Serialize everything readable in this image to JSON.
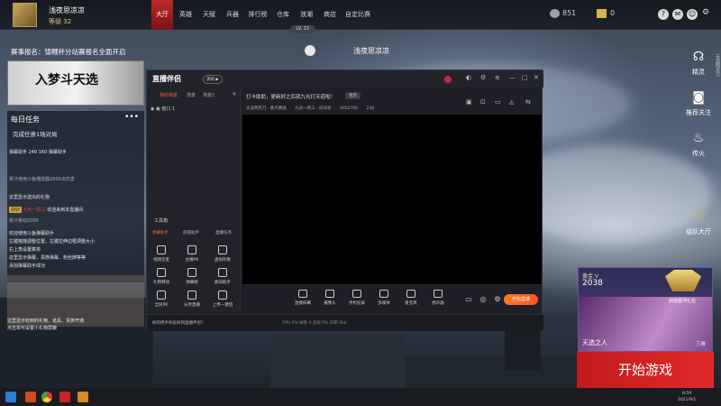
{
  "player": {
    "name": "浅夜思凉凉",
    "level": "等级 32"
  },
  "nav": {
    "tabs": [
      {
        "label": "大厅",
        "active": true
      },
      {
        "label": "英雄"
      },
      {
        "label": "天赋"
      },
      {
        "label": "兵器"
      },
      {
        "label": "排行榜"
      },
      {
        "label": "仓库"
      },
      {
        "label": "浪潮"
      },
      {
        "label": "商店"
      },
      {
        "label": "自定比赛"
      }
    ],
    "level_pill": "LV. 15",
    "currency_1": "851",
    "currency_2": "0"
  },
  "center": {
    "name": "浅夜思凉凉"
  },
  "left": {
    "event_title": "赛事报名：锦鲤杯分站赛报名全面开启",
    "event_banner_text": "入梦斗天选",
    "task_title": "每日任务",
    "task_more": "•••",
    "task_text": "完成任意1场对局",
    "chat": [
      "弹幕助手         240      160          弹幕助手",
      "累计使用斗鱼播放器2000点伤害",
      "这里显示送出的礼物",
      "欢迎来到本直播间",
      "累计移动2000",
      "欢迎使用斗鱼弹幕助手",
      "左键拖拽调整位置，左键拉伸边框调整大小",
      "右上角设置菜单",
      "这里显示弹幕，贵族弹幕、粉丝牌等等",
      "添加弹幕助手成功"
    ],
    "name_tag": "卯卯",
    "red_tag": "九光一把三",
    "hint_1": "这里显示收到的礼物、道具、贵族开通",
    "hint_2": "点击单可设置小礼物屏蔽"
  },
  "app": {
    "logo": "直播伴侣",
    "badge": "测试 ▶",
    "side_tabs": [
      "我的场景",
      "场景",
      "场景2"
    ],
    "scene_item": "窗口 1",
    "side_tabs2": [
      "弹幕助手",
      "房管助手",
      "直播任务"
    ],
    "tools_label": "工具箱",
    "side_icons": [
      "视频连麦",
      "主播PK",
      "虚拟形象",
      "礼物特效",
      "弹幕姬",
      "歌词助手",
      "全民PK",
      "分享直播",
      "上传一键回"
    ],
    "notice": "打卡助助，更新好之后就九光打天道啦！",
    "notice_button": "更新",
    "room": [
      "天涯明月刀 · 重点赛链",
      "九光一把三 · 房间号",
      "1652700",
      "234"
    ],
    "tools": [
      "直播屏幕",
      "摄像头",
      "手机投屏",
      "多媒体",
      "麦克风",
      "扬声器"
    ],
    "start_live": "开始直播",
    "footer_tip": "如何把手机投屏到直播伴侣？",
    "footer_stats": "CPU 0%   帧率 0   丢帧 0%   码率 0kb"
  },
  "right": {
    "items": [
      {
        "label": "精灵",
        "icon": "headset-icon"
      },
      {
        "label": "推荐关注",
        "icon": "camera-icon"
      },
      {
        "label": "传火",
        "icon": "flame-icon"
      },
      {
        "label": "组队大厅",
        "icon": "team-icon"
      }
    ],
    "strip": "天涯明月刀"
  },
  "rank": {
    "tier": "黄金 V",
    "points": "2038",
    "sub": "启动首冲礼包",
    "hero": "天选之人",
    "mode": "三排"
  },
  "start_game": "开始游戏",
  "clock": {
    "time": "8:59",
    "date": "2021/9/1"
  }
}
